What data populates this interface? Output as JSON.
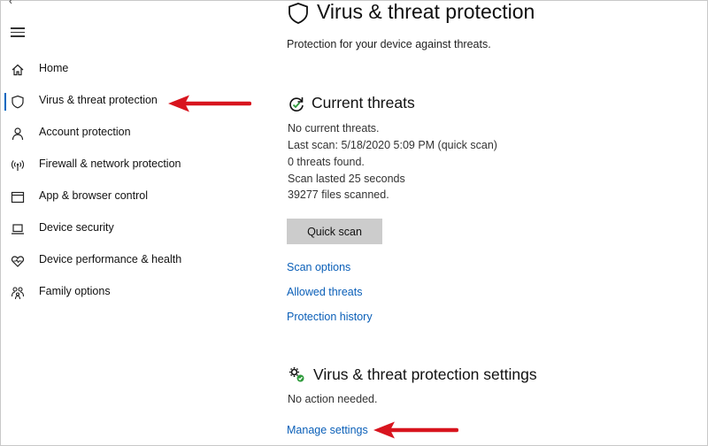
{
  "window": {
    "back_fragment": "‹"
  },
  "sidebar": {
    "items": [
      {
        "label": "Home",
        "icon": "home-icon"
      },
      {
        "label": "Virus & threat protection",
        "icon": "shield-icon",
        "active": true
      },
      {
        "label": "Account protection",
        "icon": "person-icon"
      },
      {
        "label": "Firewall & network protection",
        "icon": "wifi-antenna-icon"
      },
      {
        "label": "App & browser control",
        "icon": "app-window-icon"
      },
      {
        "label": "Device security",
        "icon": "laptop-icon"
      },
      {
        "label": "Device performance & health",
        "icon": "heart-icon"
      },
      {
        "label": "Family options",
        "icon": "family-icon"
      }
    ]
  },
  "main": {
    "title": "Virus & threat protection",
    "subtitle": "Protection for your device against threats.",
    "current_threats": {
      "title": "Current threats",
      "lines": [
        "No current threats.",
        "Last scan: 5/18/2020 5:09 PM (quick scan)",
        "0 threats found.",
        "Scan lasted 25 seconds",
        "39277 files scanned."
      ],
      "quick_scan_label": "Quick scan",
      "links": [
        "Scan options",
        "Allowed threats",
        "Protection history"
      ]
    },
    "settings": {
      "title": "Virus & threat protection settings",
      "status": "No action needed.",
      "manage_link": "Manage settings"
    }
  },
  "colors": {
    "accent": "#0067c0",
    "link": "#0a5fb8",
    "annotation_arrow": "#d8141e",
    "button_bg": "#cccccc",
    "status_green": "#2d9a3a"
  }
}
